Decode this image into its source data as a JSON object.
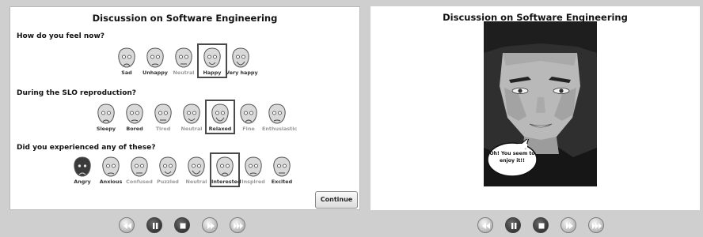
{
  "left_panel": {
    "title": "Discussion on Software Engineering",
    "questions": [
      {
        "text": "How do you feel now?",
        "options": [
          {
            "label": "Sad",
            "state": "normal"
          },
          {
            "label": "Unhappy",
            "state": "normal"
          },
          {
            "label": "Neutral",
            "state": "dim"
          },
          {
            "label": "Happy",
            "state": "selected"
          },
          {
            "label": "Very happy",
            "state": "normal"
          }
        ]
      },
      {
        "text": "During the SLO reproduction?",
        "options": [
          {
            "label": "Sleepy",
            "state": "normal"
          },
          {
            "label": "Bored",
            "state": "normal"
          },
          {
            "label": "Tired",
            "state": "dim"
          },
          {
            "label": "Neutral",
            "state": "dim"
          },
          {
            "label": "Relaxed",
            "state": "selected"
          },
          {
            "label": "Fine",
            "state": "dim"
          },
          {
            "label": "Enthusiastic",
            "state": "dim"
          }
        ]
      },
      {
        "text": "Did you experienced any of these?",
        "options": [
          {
            "label": "Angry",
            "state": "normal"
          },
          {
            "label": "Anxious",
            "state": "normal"
          },
          {
            "label": "Confused",
            "state": "dim"
          },
          {
            "label": "Puzzled",
            "state": "dim"
          },
          {
            "label": "Neutral",
            "state": "dim"
          },
          {
            "label": "Interested",
            "state": "selected"
          },
          {
            "label": "Inspired",
            "state": "dim"
          },
          {
            "label": "Excited",
            "state": "normal"
          }
        ]
      }
    ],
    "continue_label": "Continue"
  },
  "right_panel": {
    "title": "Discussion on Software Engineering",
    "speech_bubble": [
      "Oh! You seem to",
      "enjoy it!!"
    ]
  },
  "media_controls": {
    "left": [
      {
        "icon": "rewind-icon",
        "style": "light"
      },
      {
        "icon": "pause-icon",
        "style": "dark"
      },
      {
        "icon": "stop-icon",
        "style": "dark"
      },
      {
        "icon": "forward-icon",
        "style": "light"
      },
      {
        "icon": "fast-forward-icon",
        "style": "light"
      }
    ],
    "right": [
      {
        "icon": "rewind-icon",
        "style": "light"
      },
      {
        "icon": "pause-icon",
        "style": "dark"
      },
      {
        "icon": "stop-icon",
        "style": "dark"
      },
      {
        "icon": "forward-icon",
        "style": "light"
      },
      {
        "icon": "fast-forward-icon",
        "style": "light"
      }
    ]
  },
  "colors": {
    "background": "#cfcfcf",
    "panel": "#ffffff",
    "selected_border": "#4a4a4a",
    "dim_label": "#9a9a9a"
  }
}
